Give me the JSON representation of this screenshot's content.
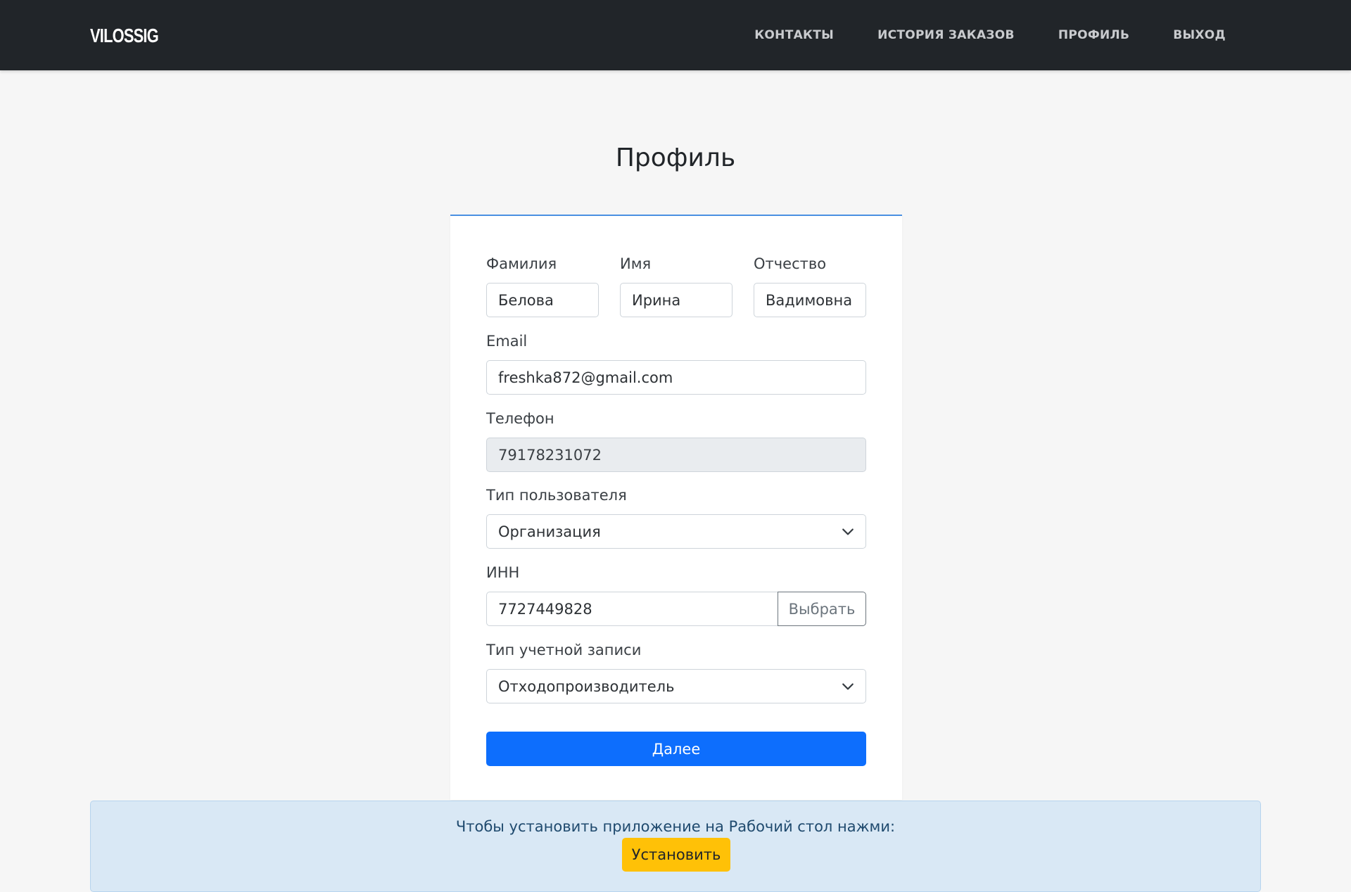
{
  "navbar": {
    "logo_text": "VILOSSIG",
    "links": [
      {
        "label": "КОНТАКТЫ"
      },
      {
        "label": "ИСТОРИЯ ЗАКАЗОВ"
      },
      {
        "label": "ПРОФИЛЬ"
      },
      {
        "label": "ВЫХОД"
      }
    ],
    "background": "#212529"
  },
  "page": {
    "title": "Профиль"
  },
  "form": {
    "last_name": {
      "label": "Фамилия",
      "value": "Белова"
    },
    "first_name": {
      "label": "Имя",
      "value": "Ирина"
    },
    "patronymic": {
      "label": "Отчество",
      "value": "Вадимовна"
    },
    "email": {
      "label": "Email",
      "value": "freshka872@gmail.com"
    },
    "phone": {
      "label": "Телефон",
      "value": "79178231072",
      "disabled": true
    },
    "user_type": {
      "label": "Тип пользователя",
      "selected": "Организация"
    },
    "inn": {
      "label": "ИНН",
      "value": "7727449828",
      "button_label": "Выбрать"
    },
    "account_type": {
      "label": "Тип учетной записи",
      "selected": "Отходопроизводитель"
    },
    "submit_label": "Далее",
    "accent_color": "#0d6efd"
  },
  "install_banner": {
    "text": "Чтобы установить приложение на Рабочий стол нажми:",
    "button_label": "Установить",
    "button_color": "#ffc107",
    "background": "#d9e8f5"
  }
}
